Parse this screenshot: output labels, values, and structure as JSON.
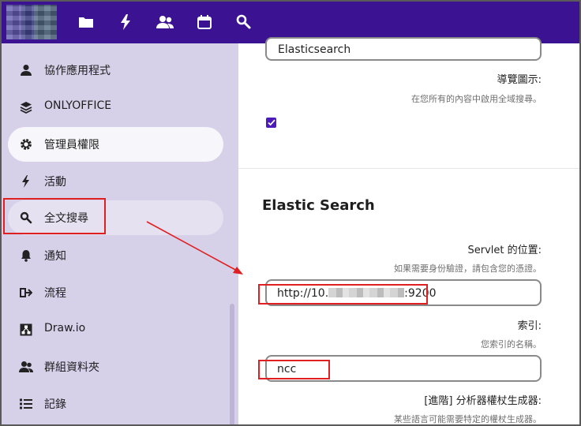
{
  "sidebar": {
    "items": [
      {
        "label": "協作應用程式",
        "icon": "user-icon"
      },
      {
        "label": "ONLYOFFICE",
        "icon": "layers-icon"
      },
      {
        "label": "管理員權限",
        "icon": "gear-icon"
      },
      {
        "label": "活動",
        "icon": "lightning-icon"
      },
      {
        "label": "全文搜尋",
        "icon": "search-icon"
      },
      {
        "label": "通知",
        "icon": "bell-icon"
      },
      {
        "label": "流程",
        "icon": "flow-icon"
      },
      {
        "label": "Draw.io",
        "icon": "drawio-icon"
      },
      {
        "label": "群組資料夾",
        "icon": "group-icon"
      },
      {
        "label": "記錄",
        "icon": "list-icon"
      }
    ]
  },
  "main": {
    "platform_value": "Elasticsearch",
    "navigation_icon_label": "導覽圖示:",
    "navigation_icon_hint": "在您所有的內容中啟用全域搜尋。",
    "navigation_icon_checked": true,
    "section_title": "Elastic Search",
    "servlet_label": "Servlet 的位置:",
    "servlet_hint": "如果需要身份驗證，請包含您的憑證。",
    "servlet_value_prefix": "http://10.",
    "servlet_value_suffix": ":9200",
    "index_label": "索引:",
    "index_hint": "您索引的名稱。",
    "index_value": "ncc",
    "analyzer_label": "[進階] 分析器權杖生成器:",
    "analyzer_hint": "某些語言可能需要特定的權杖生成器。"
  },
  "colors": {
    "header": "#3b1292",
    "sidebar": "#d7d0e9",
    "annotation": "#e02020",
    "checkbox": "#4d1cb8"
  }
}
